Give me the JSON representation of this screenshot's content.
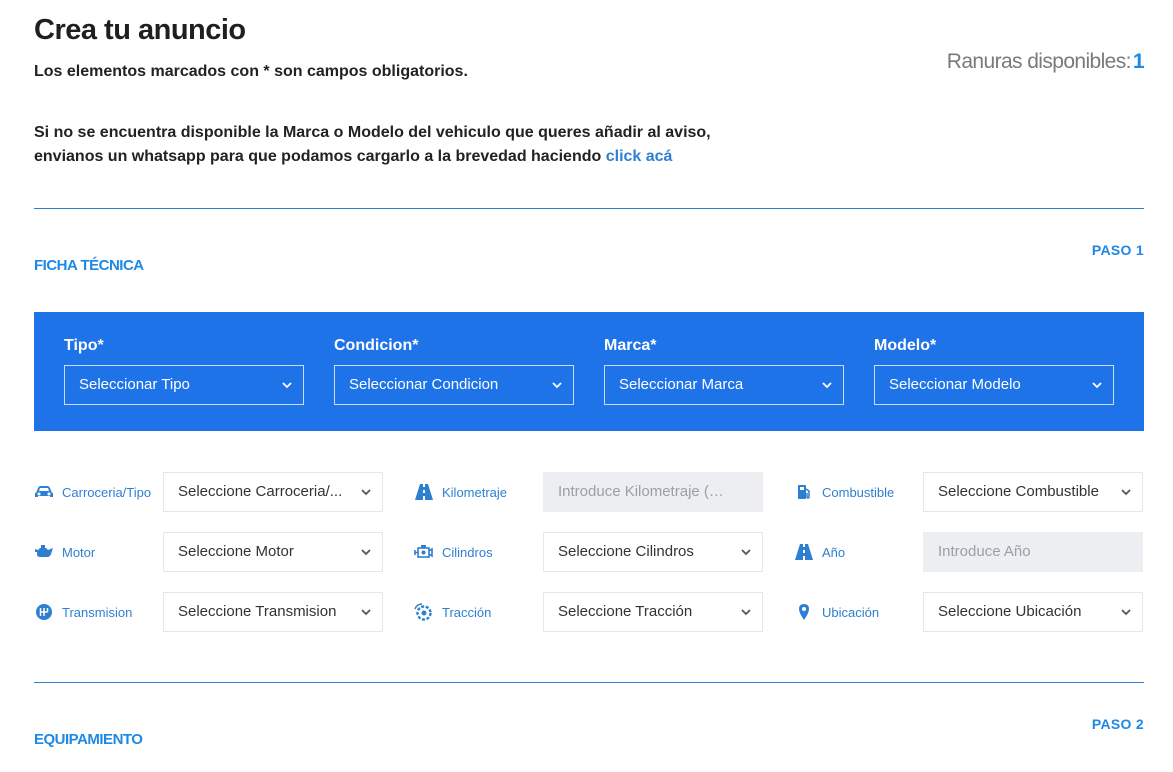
{
  "header": {
    "title": "Crea tu anuncio",
    "required_note": "Los elementos marcados con * son campos obligatorios.",
    "slots_label": "Ranuras disponibles:",
    "slots_count": "1",
    "info_line1": "Si no se encuentra disponible la Marca o Modelo del vehiculo que queres añadir al aviso,",
    "info_line2": "envianos un whatsapp para que podamos cargarlo a la brevedad haciendo",
    "info_link": "click acá"
  },
  "section1": {
    "title": "FICHA TÉCNICA",
    "step": "PASO 1",
    "main_fields": [
      {
        "label": "Tipo*",
        "value": "Seleccionar Tipo"
      },
      {
        "label": "Condicion*",
        "value": "Seleccionar Condicion"
      },
      {
        "label": "Marca*",
        "value": "Seleccionar Marca"
      },
      {
        "label": "Modelo*",
        "value": "Seleccionar Modelo"
      }
    ],
    "specs": [
      {
        "label": "Carroceria/Tipo",
        "value": "Seleccione Carroceria/...",
        "icon": "car-icon"
      },
      {
        "label": "Kilometraje",
        "placeholder": "Introduce Kilometraje (km)",
        "icon": "road-icon"
      },
      {
        "label": "Combustible",
        "value": "Seleccione Combustible",
        "icon": "fuel-pump-icon"
      },
      {
        "label": "Motor",
        "value": "Seleccione Motor",
        "icon": "engine-oil-icon"
      },
      {
        "label": "Cilindros",
        "value": "Seleccione Cilindros",
        "icon": "engine-icon"
      },
      {
        "label": "Año",
        "placeholder": "Introduce Año",
        "icon": "road-icon"
      },
      {
        "label": "Transmision",
        "value": "Seleccione Transmision",
        "icon": "gearbox-icon"
      },
      {
        "label": "Tracción",
        "value": "Seleccione Tracción",
        "icon": "wheel-gear-icon"
      },
      {
        "label": "Ubicación",
        "value": "Seleccione Ubicación",
        "icon": "location-pin-icon"
      }
    ]
  },
  "section2": {
    "title": "EQUIPAMIENTO",
    "step": "PASO 2"
  },
  "colors": {
    "accent": "#1e88e5",
    "panel": "#1e73e8",
    "link": "#2f7fd1",
    "input_bg": "#eceef1"
  }
}
